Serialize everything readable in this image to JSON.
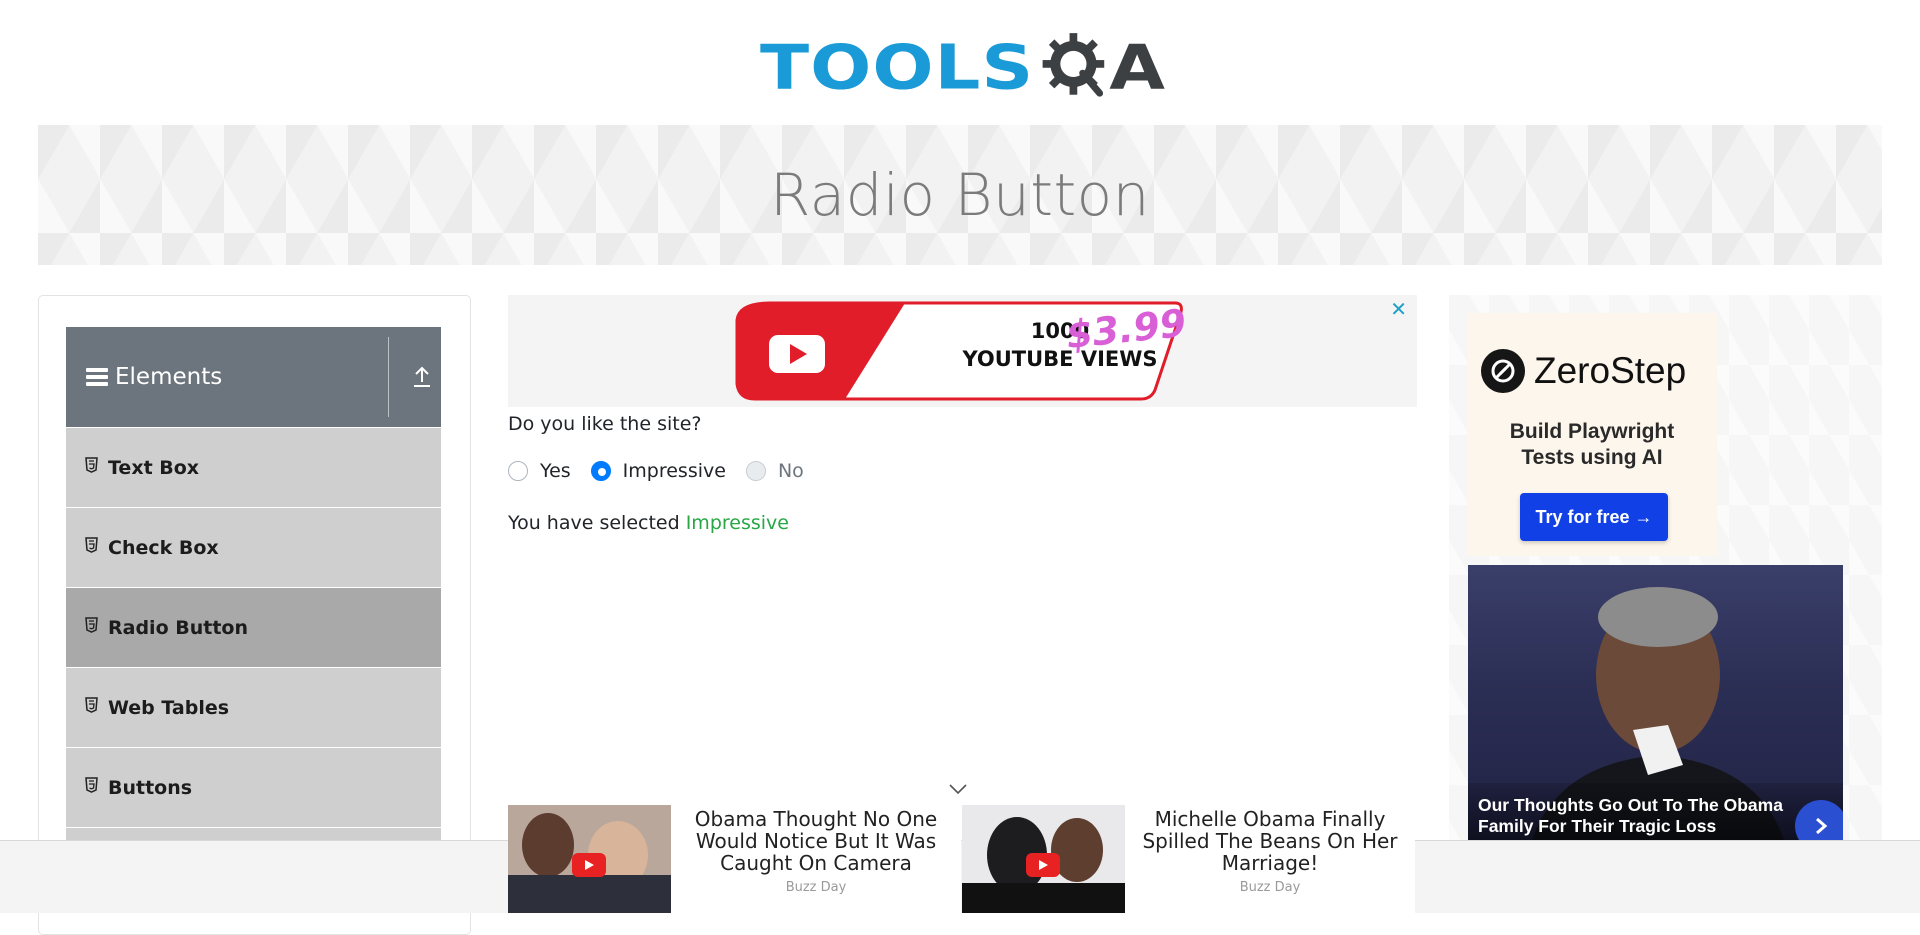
{
  "header": {
    "logo_text": "TOOLS",
    "logo_suffix": "A"
  },
  "banner": {
    "title": "Radio Button"
  },
  "sidebar": {
    "group_title": "Elements",
    "items": [
      {
        "label": "Text Box"
      },
      {
        "label": "Check Box"
      },
      {
        "label": "Radio Button",
        "active": true
      },
      {
        "label": "Web Tables"
      },
      {
        "label": "Buttons"
      }
    ]
  },
  "top_ad": {
    "close_glyph": "✕",
    "line1": "1000",
    "line2": "YOUTUBE VIEWS",
    "price": "$3.99"
  },
  "main": {
    "question": "Do you like the site?",
    "options": [
      {
        "label": "Yes",
        "checked": false,
        "disabled": false
      },
      {
        "label": "Impressive",
        "checked": true,
        "disabled": false
      },
      {
        "label": "No",
        "checked": false,
        "disabled": true
      }
    ],
    "result_prefix": "You have selected ",
    "result_value": "Impressive"
  },
  "right_ad": {
    "brand": "ZeroStep",
    "tagline_line1": "Build Playwright",
    "tagline_line2": "Tests using AI",
    "cta": "Try for free →",
    "news_caption": "Our Thoughts Go Out To The Obama Family For Their Tragic Loss"
  },
  "bottom_ads": [
    {
      "headline": "Obama Thought No One Would Notice But It Was Caught On Camera",
      "source": "Buzz Day"
    },
    {
      "headline": "Michelle Obama Finally Spilled The Beans On Her Marriage!",
      "source": "Buzz Day"
    }
  ],
  "colors": {
    "accent_blue": "#007bff",
    "selected_green": "#28a745",
    "logo_blue": "#1a9bd7",
    "menu_header": "#6c757d"
  }
}
